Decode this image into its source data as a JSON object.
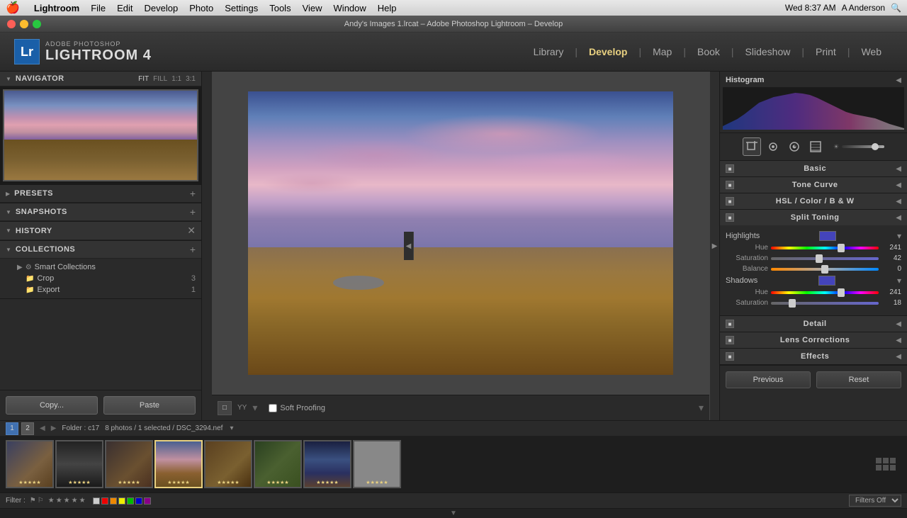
{
  "system": {
    "apple": "🍎",
    "app_name": "Lightroom",
    "menu_items": [
      "Lightroom",
      "File",
      "Edit",
      "Develop",
      "Photo",
      "Settings",
      "Tools",
      "View",
      "Window",
      "Help"
    ],
    "clock": "Wed 8:37 AM",
    "user": "A Anderson",
    "title_bar": "Andy's Images 1.lrcat – Adobe Photoshop Lightroom – Develop"
  },
  "logo": {
    "badge": "Lr",
    "adobe_label": "ADOBE PHOTOSHOP",
    "product_name": "LIGHTROOM 4"
  },
  "nav_tabs": {
    "library": "Library",
    "develop": "Develop",
    "map": "Map",
    "book": "Book",
    "slideshow": "Slideshow",
    "print": "Print",
    "web": "Web"
  },
  "left_panel": {
    "navigator": {
      "title": "Navigator",
      "fit": "FIT",
      "fill": "FILL",
      "ratio1": "1:1",
      "ratio3": "3:1"
    },
    "presets": {
      "title": "Presets",
      "collapsed": true
    },
    "snapshots": {
      "title": "Snapshots"
    },
    "history": {
      "title": "History"
    },
    "collections": {
      "title": "Collections",
      "items": [
        {
          "label": "Smart Collections",
          "icon": "▶",
          "indent": 1
        },
        {
          "label": "Crop",
          "icon": "📁",
          "indent": 2,
          "count": "3"
        },
        {
          "label": "Export",
          "icon": "📁",
          "indent": 2,
          "count": "1"
        }
      ]
    }
  },
  "photo_toolbar": {
    "view_btn": "□",
    "yy_label": "YY",
    "soft_proofing": "Soft Proofing"
  },
  "right_panel": {
    "histogram": {
      "title": "Histogram"
    },
    "tools": {
      "icons": [
        "⊞",
        "◎",
        "⊙",
        "□"
      ]
    },
    "basic": {
      "title": "Basic",
      "collapsed": false
    },
    "tone_curve": {
      "title": "Tone Curve",
      "collapsed": false
    },
    "hsl": {
      "label": "HSL / Color / B & W"
    },
    "split_toning": {
      "title": "Split Toning",
      "highlights_label": "Highlights",
      "shadows_label": "Shadows",
      "hue_label": "Hue",
      "saturation_label": "Saturation",
      "balance_label": "Balance",
      "highlights_hue_value": "241",
      "highlights_sat_value": "42",
      "balance_value": "0",
      "shadows_hue_value": "241",
      "shadows_sat_value": "18",
      "highlights_hue_pct": 65,
      "highlights_sat_pct": 45,
      "balance_pct": 50,
      "shadows_hue_pct": 65,
      "shadows_sat_pct": 20,
      "highlight_color": "#4444bb",
      "shadow_color": "#4444bb"
    },
    "detail": {
      "title": "Detail"
    },
    "lens_corrections": {
      "title": "Lens Corrections"
    },
    "effects": {
      "title": "Effects"
    },
    "prev_btn": "Previous",
    "reset_btn": "Reset"
  },
  "bottom_bar": {
    "page1": "1",
    "page2": "2",
    "folder": "Folder : c17",
    "photo_info": "8 photos / 1 selected / DSC_3294.nef",
    "filter_label": "Filter :",
    "filters_off": "Filters Off"
  },
  "copy_paste": {
    "copy": "Copy...",
    "paste": "Paste"
  }
}
